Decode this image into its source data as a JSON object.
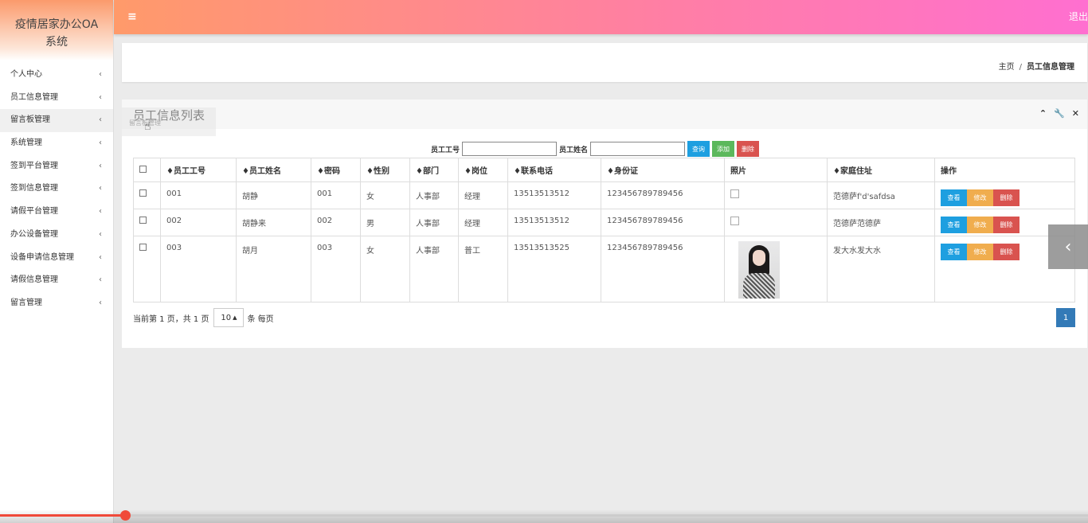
{
  "app": {
    "title": "疫情居家办公OA系统",
    "title_line1": "疫情居家办公OA",
    "title_line2": "系统"
  },
  "topbar": {
    "menu_icon": "≡",
    "logout": "退出"
  },
  "sidebar": {
    "items": [
      {
        "label": "个人中心"
      },
      {
        "label": "员工信息管理"
      },
      {
        "label": "留言板管理"
      },
      {
        "label": "系统管理"
      },
      {
        "label": "签到平台管理"
      },
      {
        "label": "签到信息管理"
      },
      {
        "label": "请假平台管理"
      },
      {
        "label": "办公设备管理"
      },
      {
        "label": "设备申请信息管理"
      },
      {
        "label": "请假信息管理"
      },
      {
        "label": "留言管理"
      }
    ],
    "chevron": "‹",
    "active_index": 2
  },
  "breadcrumb": {
    "home": "主页",
    "separator": "/",
    "current": "员工信息管理"
  },
  "card": {
    "title": "员工信息列表",
    "ghost_tab": "留言板管理",
    "tools": {
      "collapse": "⌃",
      "wrench": "🔧",
      "close": "✕"
    }
  },
  "search": {
    "id_label": "员工工号",
    "id_value": "",
    "name_label": "员工姓名",
    "name_value": "",
    "query": "查询",
    "add": "添加",
    "delete": "删除"
  },
  "table": {
    "headers": [
      "♦员工工号",
      "♦员工姓名",
      "♦密码",
      "♦性别",
      "♦部门",
      "♦岗位",
      "♦联系电话",
      "♦身份证",
      "照片",
      "♦家庭住址",
      "操作"
    ],
    "rows": [
      {
        "id": "001",
        "name": "胡静",
        "password": "001",
        "gender": "女",
        "dept": "人事部",
        "post": "经理",
        "phone": "13513513512",
        "idcard": "123456789789456",
        "photo": "broken",
        "address": "范德萨f'd'safdsa"
      },
      {
        "id": "002",
        "name": "胡静来",
        "password": "002",
        "gender": "男",
        "dept": "人事部",
        "post": "经理",
        "phone": "13513513512",
        "idcard": "123456789789456",
        "photo": "broken",
        "address": "范德萨范德萨"
      },
      {
        "id": "003",
        "name": "胡月",
        "password": "003",
        "gender": "女",
        "dept": "人事部",
        "post": "普工",
        "phone": "13513513525",
        "idcard": "123456789789456",
        "photo": "portrait",
        "address": "发大水发大水"
      }
    ],
    "row_actions": {
      "view": "查看",
      "edit": "修改",
      "delete": "删除"
    }
  },
  "pager": {
    "info": "当前第 1 页，共 1 页",
    "page_size": "10",
    "per_page": "条 每页",
    "current_page": "1"
  },
  "side_arrow": "‹",
  "video_progress": 0.115,
  "colors": {
    "accent_blue": "#1e9fe0",
    "green": "#5cb85c",
    "red": "#d9534f",
    "orange": "#f0ad4e",
    "page_blue": "#337ab7"
  }
}
